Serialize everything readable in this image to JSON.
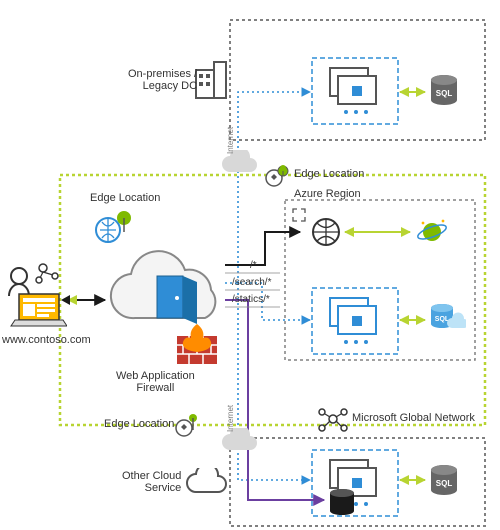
{
  "labels": {
    "onprem": "On-premises /\nLegacy DC",
    "edge_top": "Edge Location",
    "edge_inside": "Edge Location",
    "azure_region": "Azure Region",
    "website": "www.contoso.com",
    "waf": "Web Application\nFirewall",
    "edge_bottom": "Edge Location",
    "msgn": "Microsoft Global Network",
    "other_cloud": "Other Cloud\nService",
    "internet1": "Internet",
    "internet2": "Internet",
    "path_root": "/*",
    "path_search": "/search/*",
    "path_statics": "/statics/*"
  },
  "colors": {
    "greyDot": "#808080",
    "yellowGreen": "#b8d432",
    "blue": "#2f8dd6",
    "purple": "#6b3fa0",
    "black": "#1a1a1a",
    "green": "#7fba00"
  }
}
